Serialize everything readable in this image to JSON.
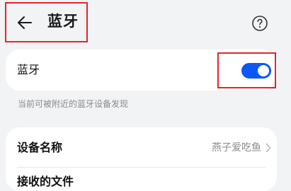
{
  "header": {
    "back_icon": "arrow-left-icon",
    "title": "蓝牙",
    "help_icon": "question-circle-icon"
  },
  "bluetooth_card": {
    "label": "蓝牙",
    "toggle_on": true,
    "toggle_color": "#0a59f7"
  },
  "hint_text": "当前可被附近的蓝牙设备发现",
  "device_card": {
    "name_label": "设备名称",
    "name_value": "燕子爱吃鱼",
    "chevron_icon": "chevron-right-icon",
    "second_row_label": "接收的文件"
  },
  "highlight_color": "#e3262b"
}
